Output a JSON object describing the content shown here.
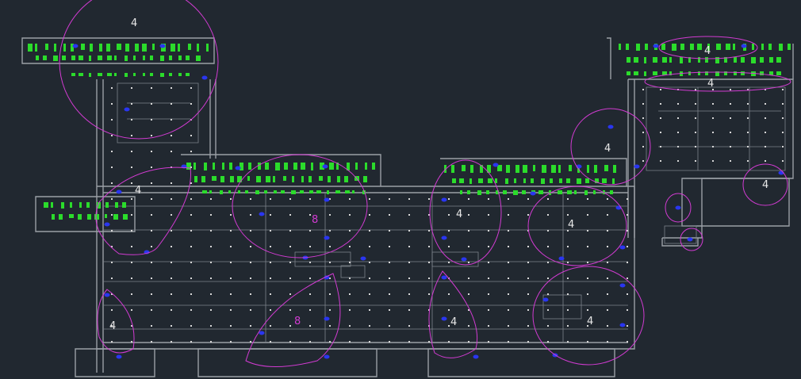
{
  "drawing": {
    "background_color": "#212830",
    "wall_color": "#9a9fa6",
    "zone_color": "#d23bd2",
    "room_fill_color": "#2bdc2b",
    "device_color": "#2a36f0",
    "column_color": "#d8d8d8"
  },
  "zones": [
    {
      "label": "4"
    },
    {
      "label": "4"
    },
    {
      "label": "4"
    },
    {
      "label": "4"
    },
    {
      "label": "4"
    },
    {
      "label": "8"
    },
    {
      "label": "4"
    },
    {
      "label": "4"
    },
    {
      "label": "4"
    },
    {
      "label": "4"
    },
    {
      "label": "8"
    },
    {
      "label": "4"
    },
    {
      "label": "4"
    }
  ]
}
